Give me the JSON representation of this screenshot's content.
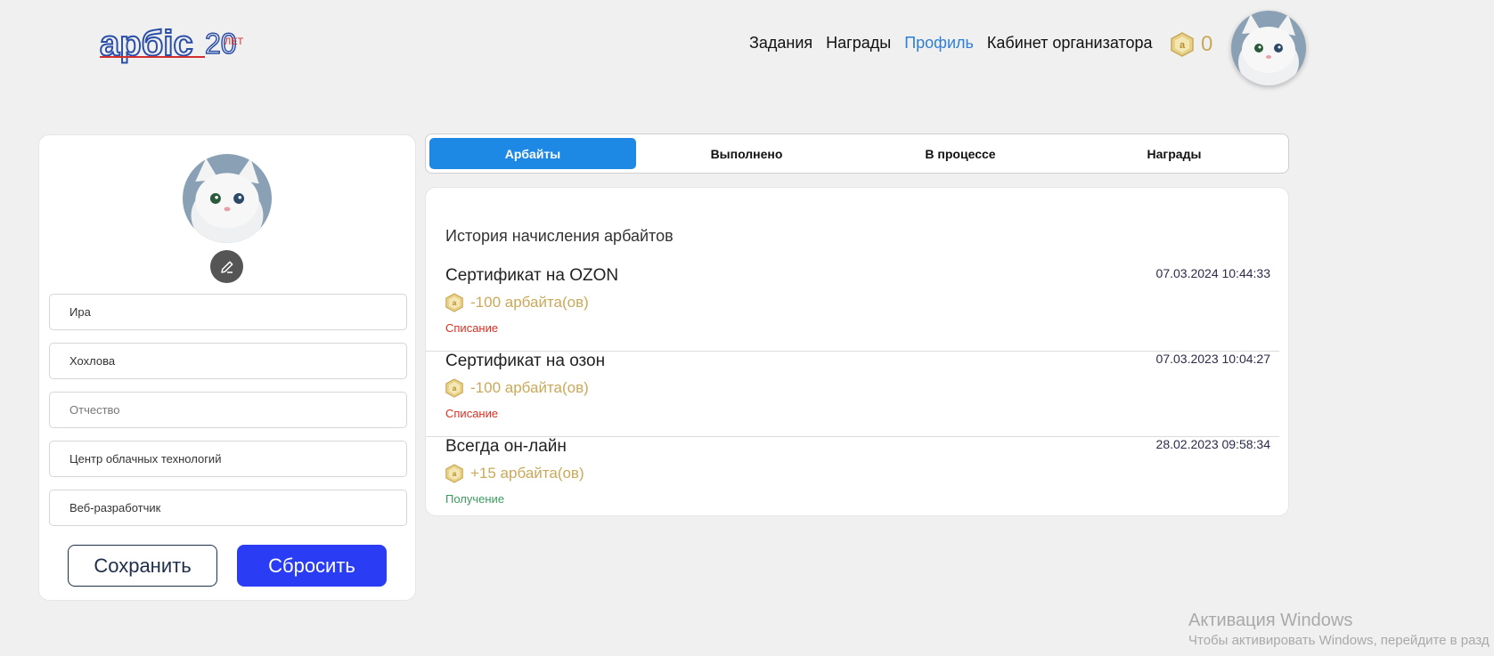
{
  "header": {
    "logo_text": "арбіс",
    "logo_badge": "20 ЛЕТ",
    "nav": [
      {
        "label": "Задания",
        "active": false
      },
      {
        "label": "Награды",
        "active": false
      },
      {
        "label": "Профиль",
        "active": true
      },
      {
        "label": "Кабинет организатора",
        "active": false
      }
    ],
    "balance": "0",
    "balance_icon": "arbit-coin-icon"
  },
  "profile": {
    "fields": [
      {
        "name": "first-name-field",
        "value": "Ира",
        "placeholder": ""
      },
      {
        "name": "last-name-field",
        "value": "Хохлова",
        "placeholder": ""
      },
      {
        "name": "patronymic-field",
        "value": "",
        "placeholder": "Отчество"
      },
      {
        "name": "department-field",
        "value": "Центр облачных технологий",
        "placeholder": ""
      },
      {
        "name": "position-field",
        "value": "Веб-разработчик",
        "placeholder": ""
      }
    ],
    "save_label": "Сохранить",
    "reset_label": "Сбросить"
  },
  "tabs": [
    {
      "label": "Арбайты",
      "active": true
    },
    {
      "label": "Выполнено",
      "active": false
    },
    {
      "label": "В процессе",
      "active": false
    },
    {
      "label": "Награды",
      "active": false
    }
  ],
  "history": {
    "title": "История начисления арбайтов",
    "entries": [
      {
        "title": "Сертификат на OZON",
        "date": "07.03.2024 10:44:33",
        "amount": "-100 арбайта(ов)",
        "type": "Списание",
        "kind": "debit"
      },
      {
        "title": "Сертификат на озон",
        "date": "07.03.2023 10:04:27",
        "amount": "-100 арбайта(ов)",
        "type": "Списание",
        "kind": "debit"
      },
      {
        "title": "Всегда он-лайн",
        "date": "28.02.2023 09:58:34",
        "amount": "+15 арбайта(ов)",
        "type": "Получение",
        "kind": "credit"
      }
    ]
  },
  "watermark": {
    "line1": "Активация Windows",
    "line2": "Чтобы активировать Windows, перейдите в разд"
  },
  "colors": {
    "accent": "#1e88e5",
    "nav_active": "#2f7fd6",
    "reset_button": "#2a3df5",
    "coin": "#c9a95a",
    "debit": "#d93025",
    "credit": "#3c9a5f"
  }
}
